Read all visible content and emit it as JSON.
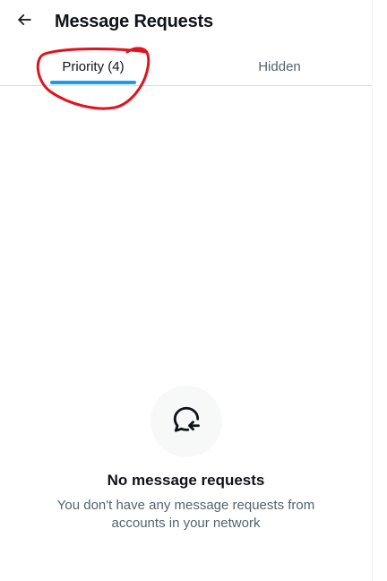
{
  "header": {
    "back_icon": "arrow-left-icon",
    "title": "Message Requests"
  },
  "tabs": [
    {
      "label": "Priority (4)",
      "selected": true
    },
    {
      "label": "Hidden",
      "selected": false
    }
  ],
  "empty_state": {
    "icon": "message-request-icon",
    "title": "No message requests",
    "description": "You don't have any message requests from accounts in your network"
  },
  "colors": {
    "accent": "#1d9bf0",
    "annotation": "#e0141e",
    "text_primary": "#0f1419",
    "text_secondary": "#536471"
  }
}
